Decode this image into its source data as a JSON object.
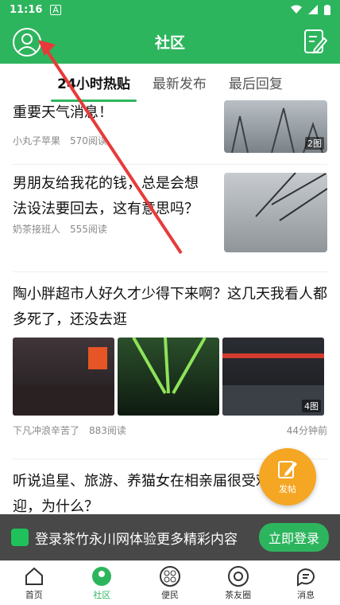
{
  "status": {
    "time": "11:16",
    "a_icon": "A"
  },
  "header": {
    "title": "社区"
  },
  "tabs": [
    "24小时热贴",
    "最新发布",
    "最后回复"
  ],
  "posts": [
    {
      "title": "重要天气消息！",
      "author": "小丸子苹果",
      "reads": "570阅读",
      "badge": "2图"
    },
    {
      "title": "男朋友给我花的钱，总是会想法设法要回去，这有意思吗？",
      "author": "奶茶接班人",
      "reads": "555阅读"
    },
    {
      "title": "陶小胖超市人好久才少得下来啊？这几天我看人都多死了，还没去逛",
      "author": "下凡冲浪辛苦了",
      "reads": "883阅读",
      "time": "44分钟前",
      "badge": "4图"
    },
    {
      "title": "听说追星、旅游、养猫女在相亲届很受欢迎，为什么？"
    }
  ],
  "fab": {
    "label": "发帖"
  },
  "banner": {
    "text": "登录茶竹永川网体验更多精彩内容",
    "button": "立即登录"
  },
  "nav": [
    "首页",
    "社区",
    "便民",
    "茶友圈",
    "消息"
  ],
  "colors": {
    "primary": "#2db55d",
    "fab": "#f5a623"
  }
}
